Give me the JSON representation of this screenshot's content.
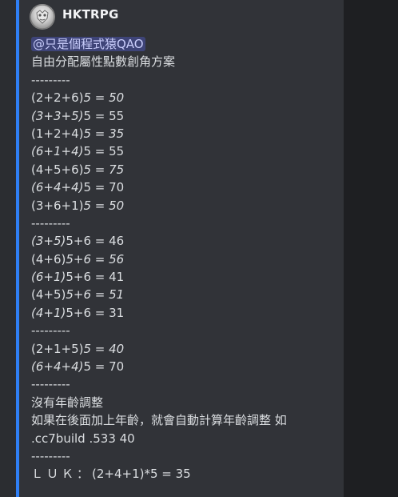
{
  "message": {
    "author": "HKTRPG",
    "mention": "@只是個程式猿QAO",
    "title": "自由分配屬性點數創角方案",
    "separator": "---------",
    "block1": [
      {
        "plain": "(2+2+6)",
        "italic": "5 = 50"
      },
      {
        "italic": "(3+3+5)",
        "plain": "5 = 55"
      },
      {
        "plain": "(1+2+4)",
        "italic": "5 = 35"
      },
      {
        "italic": "(6+1+4)",
        "plain": "5 = 55"
      },
      {
        "plain": "(4+5+6)",
        "italic": "5 = 75"
      },
      {
        "italic": "(6+4+4)",
        "plain": "5 = 70"
      },
      {
        "plain": "(3+6+1)",
        "italic": "5 = 50"
      }
    ],
    "block2": [
      {
        "italic": "(3+5)",
        "plain": "5+6 = 46"
      },
      {
        "plain": "(4+6)",
        "italic": "5+6 = 56"
      },
      {
        "italic": "(6+1)",
        "plain": "5+6 = 41"
      },
      {
        "plain": "(4+5)",
        "italic": "5+6 = 51"
      },
      {
        "italic": "(4+1)",
        "plain": "5+6 = 31"
      }
    ],
    "block3": [
      {
        "plain": "(2+1+5)",
        "italic": "5 = 40"
      },
      {
        "italic": "(6+4+4)",
        "plain": "5 = 70"
      }
    ],
    "no_age_title": "沒有年齡調整",
    "age_note": "如果在後面加上年齡，就會自動計算年齡調整 如",
    "command": ".cc7build .533 40",
    "luk_label": "ＬＵＫ：",
    "luk_value": "(2+4+1)*5 = 35"
  },
  "colors": {
    "accent_bar": "#2f7ff5",
    "mention_bg": "#3c4270",
    "text": "#dbdee1",
    "background": "#313338"
  },
  "icons": {
    "avatar": "hktrpg-bot-avatar"
  }
}
